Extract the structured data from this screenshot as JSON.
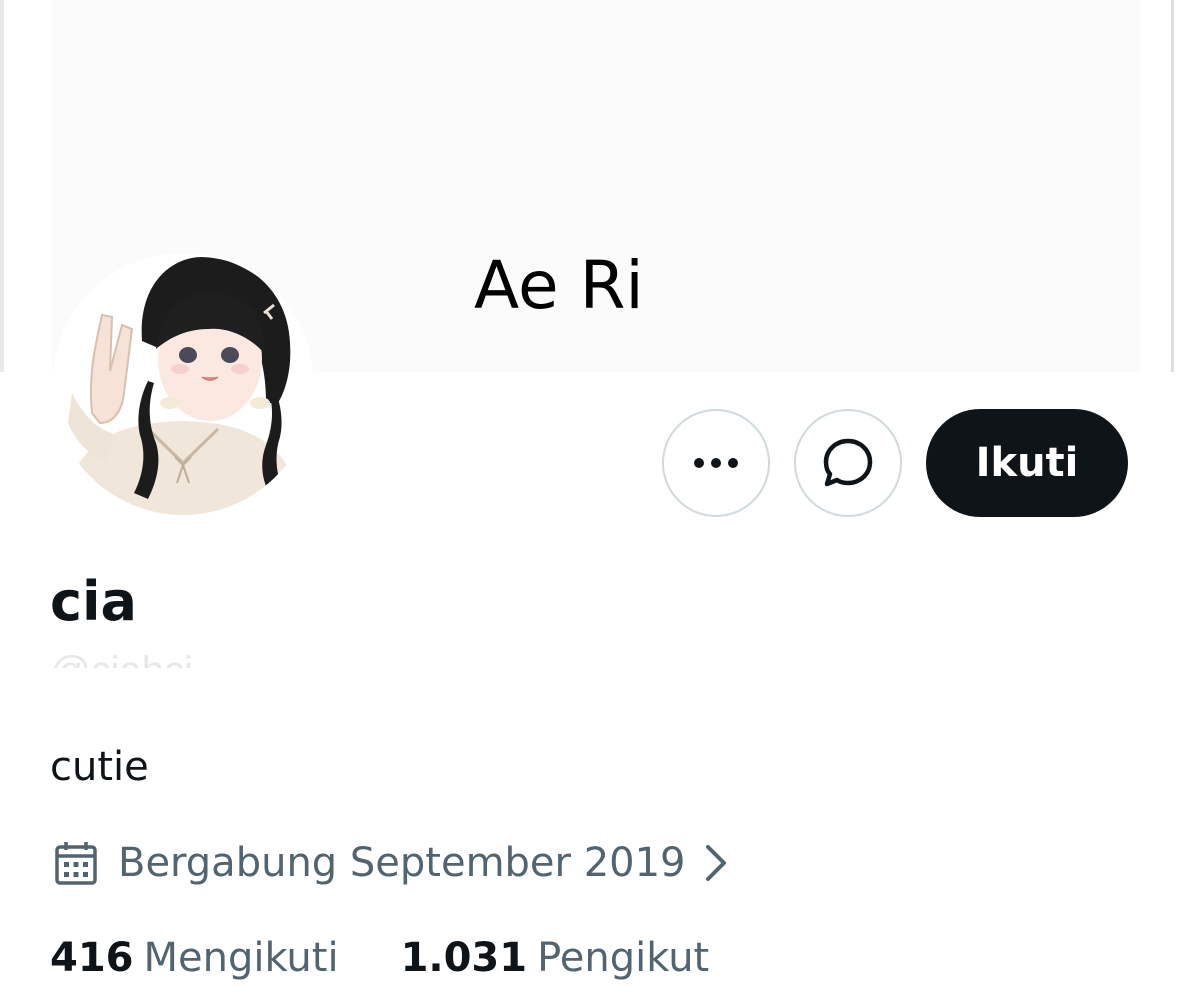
{
  "banner": {
    "title": "Ae Ri"
  },
  "profile": {
    "display_name": "cia",
    "handle": "@ciahci",
    "bio": "cutie",
    "joined": "Bergabung September 2019"
  },
  "actions": {
    "more_icon": "more-horizontal-icon",
    "message_icon": "message-bubble-icon",
    "follow_label": "Ikuti"
  },
  "stats": {
    "following_count": "416",
    "following_label": "Mengikuti",
    "followers_count": "1.031",
    "followers_label": "Pengikut"
  },
  "colors": {
    "text_primary": "#0f1419",
    "text_secondary": "#536471",
    "button_dark": "#0f1419",
    "border": "#cfd9de"
  }
}
